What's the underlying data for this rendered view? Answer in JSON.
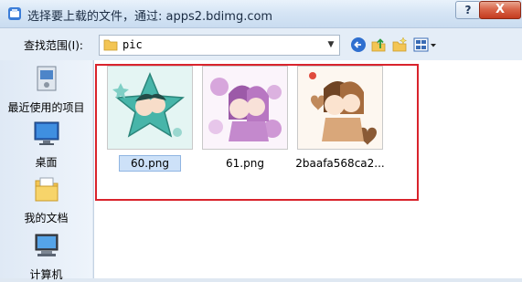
{
  "dialog": {
    "title": "选择要上载的文件，通过: apps2.bdimg.com",
    "help_label": "?",
    "close_label": "X"
  },
  "toolbar": {
    "look_in_label": "查找范围(I):",
    "current_folder": "pic",
    "icons": [
      "back-icon",
      "up-folder-icon",
      "new-folder-icon",
      "view-menu-icon"
    ]
  },
  "places": [
    {
      "label": "最近使用的项目",
      "icon": "recent-items-icon"
    },
    {
      "label": "桌面",
      "icon": "desktop-icon"
    },
    {
      "label": "我的文档",
      "icon": "my-documents-icon"
    },
    {
      "label": "计算机",
      "icon": "computer-icon"
    }
  ],
  "files": [
    {
      "name": "60.png",
      "selected": true
    },
    {
      "name": "61.png",
      "selected": false
    },
    {
      "name": "2baafa568ca2...",
      "selected": false
    }
  ],
  "colors": {
    "highlight_border": "#d9232c",
    "selection": "#cde1f8"
  }
}
